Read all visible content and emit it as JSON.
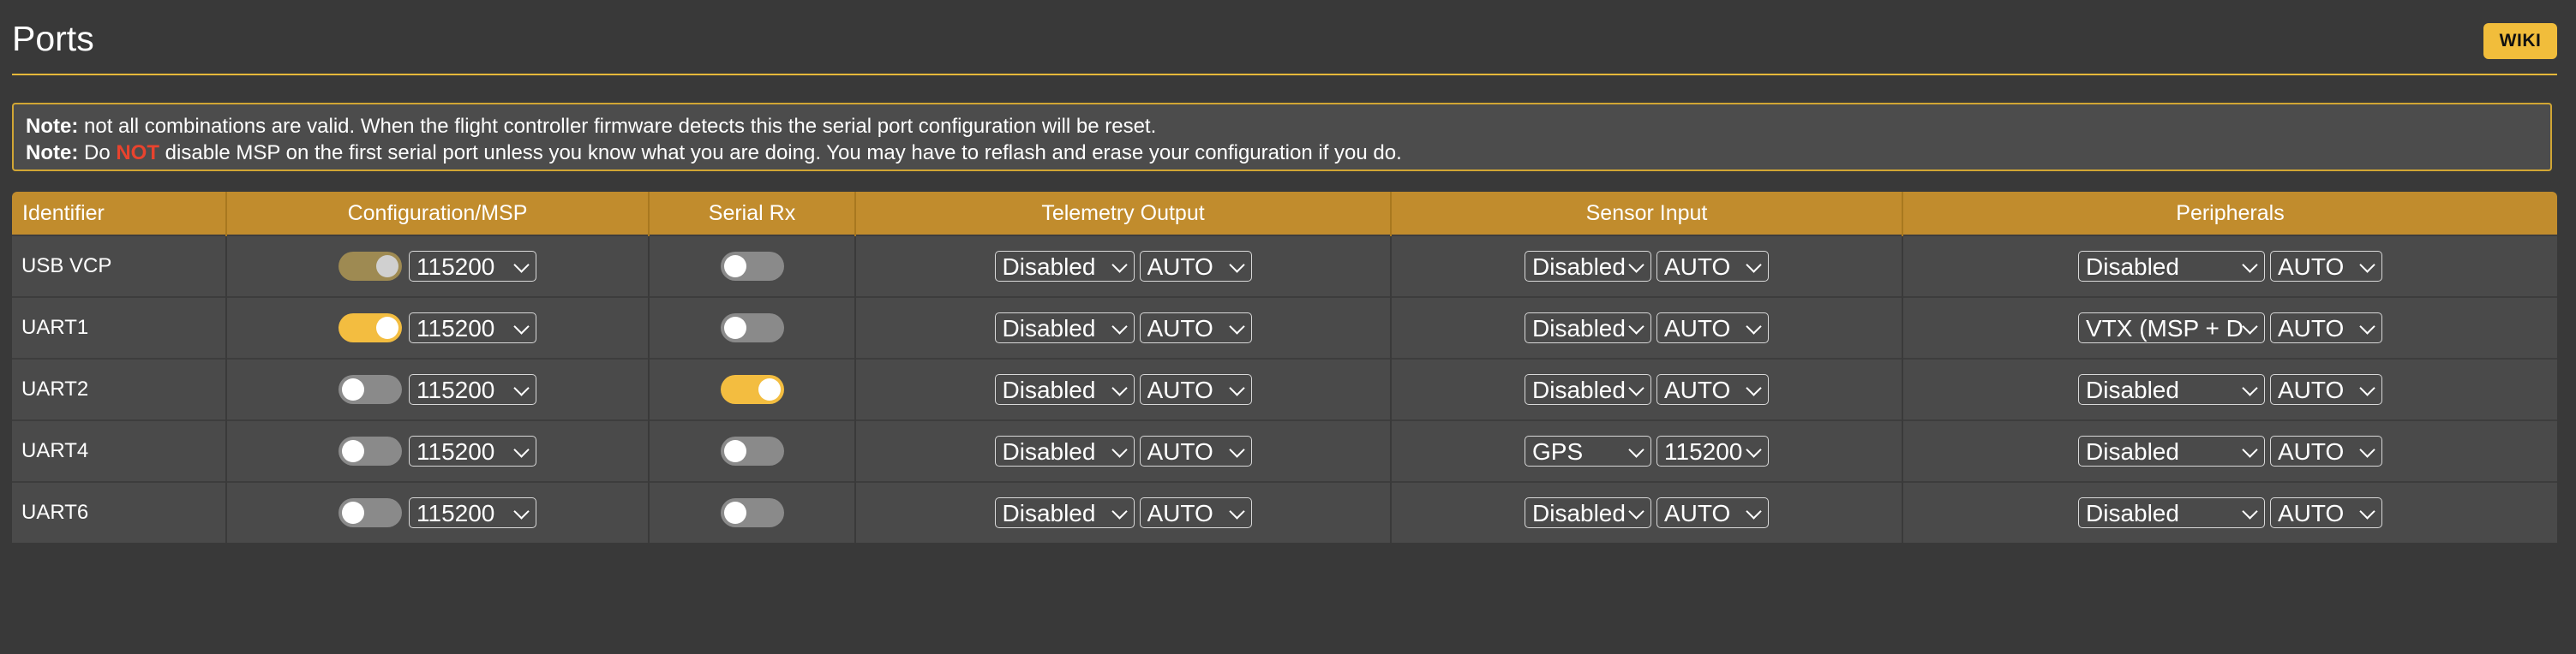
{
  "header": {
    "title": "Ports",
    "wiki_label": "WIKI"
  },
  "notes": {
    "line1_bold": "Note:",
    "line1_text": " not all combinations are valid. When the flight controller firmware detects this the serial port configuration will be reset.",
    "line2_bold": "Note:",
    "line2_pre": " Do ",
    "line2_red": "NOT",
    "line2_post": " disable MSP on the first serial port unless you know what you are doing. You may have to reflash and erase your configuration if you do."
  },
  "columns": [
    "Identifier",
    "Configuration/MSP",
    "Serial Rx",
    "Telemetry Output",
    "Sensor Input",
    "Peripherals"
  ],
  "rows": [
    {
      "id": "USB VCP",
      "msp": "locked-on",
      "msp_baud": "115200",
      "serial_rx": false,
      "tel": "Disabled",
      "tel_baud": "AUTO",
      "sen": "Disabled",
      "sen_baud": "AUTO",
      "per": "Disabled",
      "per_baud": "AUTO"
    },
    {
      "id": "UART1",
      "msp": "on",
      "msp_baud": "115200",
      "serial_rx": false,
      "tel": "Disabled",
      "tel_baud": "AUTO",
      "sen": "Disabled",
      "sen_baud": "AUTO",
      "per": "VTX (MSP + D",
      "per_baud": "AUTO"
    },
    {
      "id": "UART2",
      "msp": "off",
      "msp_baud": "115200",
      "serial_rx": true,
      "tel": "Disabled",
      "tel_baud": "AUTO",
      "sen": "Disabled",
      "sen_baud": "AUTO",
      "per": "Disabled",
      "per_baud": "AUTO"
    },
    {
      "id": "UART4",
      "msp": "off",
      "msp_baud": "115200",
      "serial_rx": false,
      "tel": "Disabled",
      "tel_baud": "AUTO",
      "sen": "GPS",
      "sen_baud": "115200",
      "per": "Disabled",
      "per_baud": "AUTO"
    },
    {
      "id": "UART6",
      "msp": "off",
      "msp_baud": "115200",
      "serial_rx": false,
      "tel": "Disabled",
      "tel_baud": "AUTO",
      "sen": "Disabled",
      "sen_baud": "AUTO",
      "per": "Disabled",
      "per_baud": "AUTO"
    }
  ],
  "colors": {
    "accent": "#f1bd3b",
    "header_row": "#c18c2d",
    "background": "#393939",
    "row": "#4a4a4a",
    "danger": "#e8432e"
  }
}
